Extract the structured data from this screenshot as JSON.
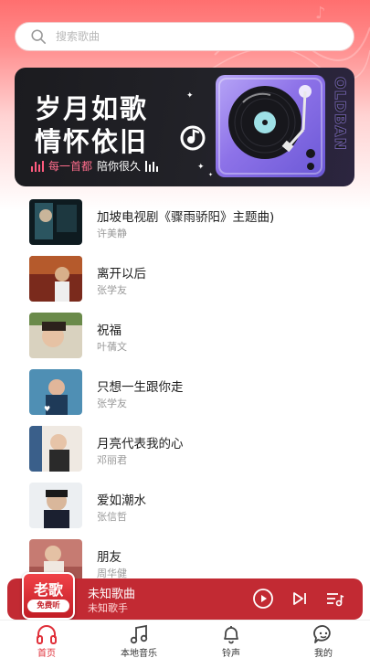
{
  "search": {
    "placeholder": "搜索歌曲",
    "icon": "search-icon"
  },
  "banner": {
    "line1": "岁月如歌",
    "line2": "情怀依旧",
    "subtitle_a": "每一首都",
    "subtitle_b": "陪你很久",
    "vertical_text": "OLDBAN"
  },
  "songs": [
    {
      "title": "加坡电视剧《骤雨骄阳》主题曲)",
      "artist": "许美静"
    },
    {
      "title": "离开以后",
      "artist": "张学友"
    },
    {
      "title": "祝福",
      "artist": "叶蒨文"
    },
    {
      "title": "只想一生跟你走",
      "artist": "张学友"
    },
    {
      "title": "月亮代表我的心",
      "artist": "邓丽君"
    },
    {
      "title": "爱如潮水",
      "artist": "张信哲"
    },
    {
      "title": "朋友",
      "artist": "周华健"
    }
  ],
  "player": {
    "logo_big": "老歌",
    "logo_small": "免费听",
    "title": "未知歌曲",
    "artist": "未知歌手"
  },
  "tabs": [
    {
      "label": "首页",
      "icon": "headphones-icon",
      "active": true
    },
    {
      "label": "本地音乐",
      "icon": "music-note-icon",
      "active": false
    },
    {
      "label": "铃声",
      "icon": "bell-icon",
      "active": false
    },
    {
      "label": "我的",
      "icon": "chat-face-icon",
      "active": false
    }
  ],
  "colors": {
    "accent": "#e0303a",
    "player_bg": "#c22a33",
    "banner_bg": "#1b1b1f"
  }
}
